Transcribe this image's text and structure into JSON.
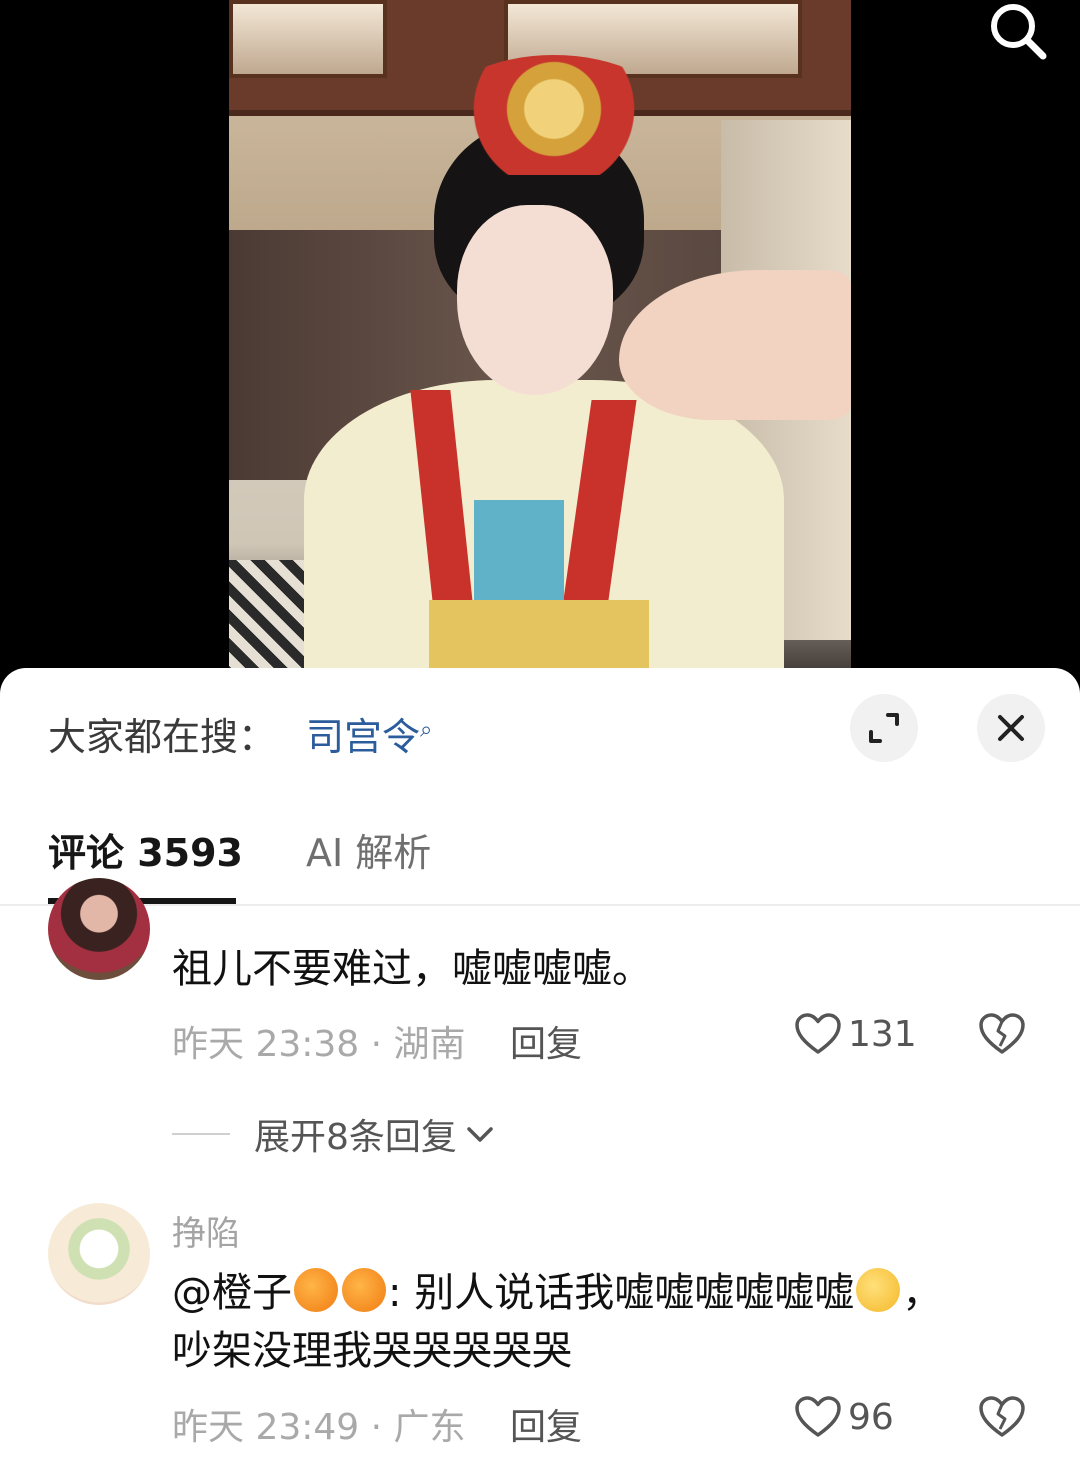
{
  "search_bar": {
    "label": "大家都在搜：",
    "term": "司宫令",
    "search_glyph": "⌕"
  },
  "tabs": [
    {
      "label": "评论 3593",
      "active": true
    },
    {
      "label": "AI 解析",
      "active": false
    }
  ],
  "comments": [
    {
      "text": "祖儿不要难过，嘘嘘嘘嘘。",
      "meta": "昨天 23:38 · 湖南",
      "reply_label": "回复",
      "likes": "131",
      "expand_label": "展开8条回复"
    },
    {
      "username": "挣陷",
      "mention": "@橙子",
      "text_main": ": 别人说话我嘘嘘嘘嘘嘘嘘",
      "text_tail": "，",
      "text_line2": "吵架没理我哭哭哭哭哭",
      "meta": "昨天 23:49 · 广东",
      "reply_label": "回复",
      "likes": "96"
    }
  ],
  "colors": {
    "accent_link": "#2b5d9c",
    "meta_gray": "#a9a9a9",
    "tab_active": "#161616"
  },
  "icons": [
    "search-icon",
    "expand-icon",
    "close-icon",
    "heart-icon",
    "broken-heart-icon",
    "chevron-down-icon"
  ]
}
